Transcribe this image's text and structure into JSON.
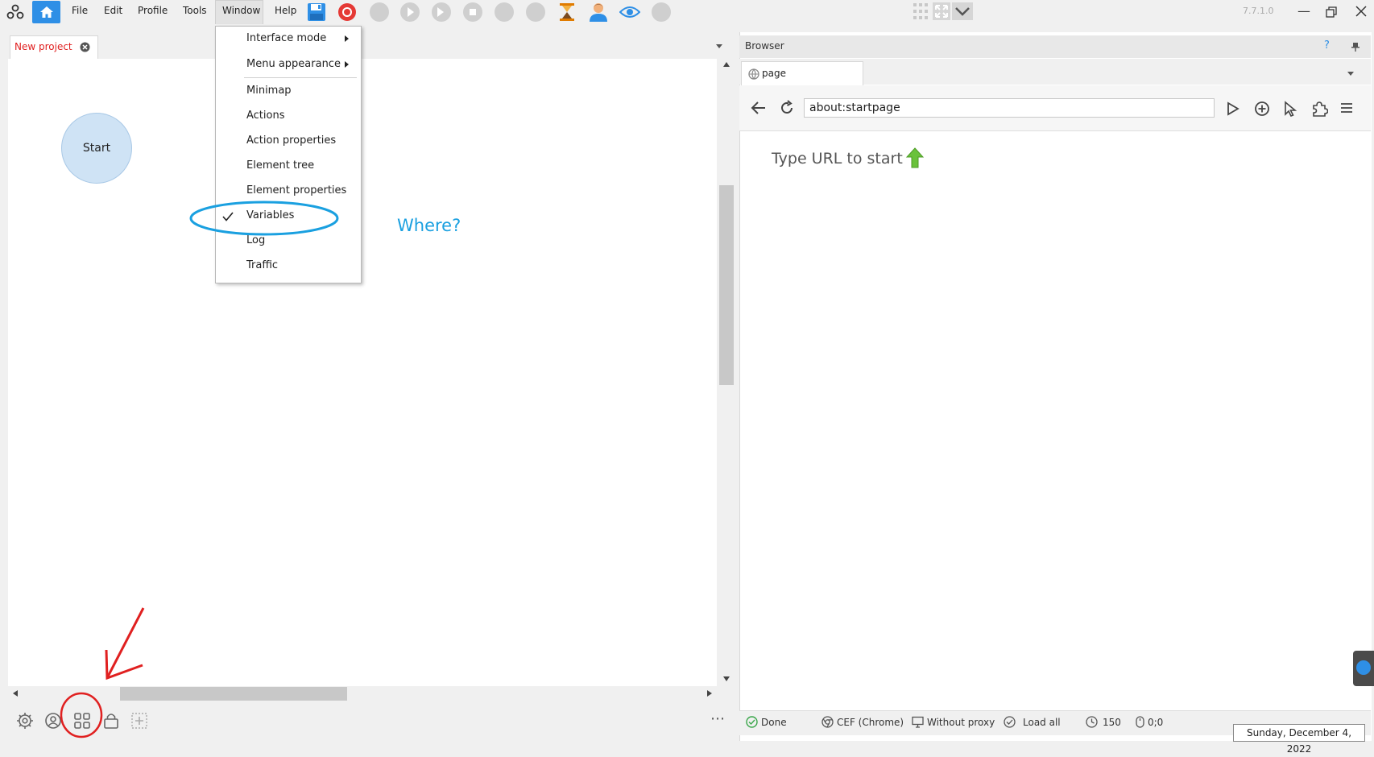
{
  "menu": {
    "file": "File",
    "edit": "Edit",
    "profile": "Profile",
    "tools": "Tools",
    "window": "Window",
    "help": "Help"
  },
  "version": "7.7.1.0",
  "project": {
    "tab_label": "New project",
    "start_node_label": "Start"
  },
  "window_menu": {
    "items": [
      {
        "label": "Interface mode",
        "submenu": true
      },
      {
        "label": "Menu appearance",
        "submenu": true
      },
      {
        "label": "Minimap"
      },
      {
        "label": "Actions"
      },
      {
        "label": "Action properties"
      },
      {
        "label": "Element tree"
      },
      {
        "label": "Element properties"
      },
      {
        "label": "Variables",
        "checked": true
      },
      {
        "label": "Log"
      },
      {
        "label": "Traffic"
      }
    ]
  },
  "annotation": {
    "where_text": "Where?"
  },
  "browser": {
    "header_title": "Browser",
    "help_glyph": "?",
    "tab_label": "page",
    "url_value": "about:startpage",
    "start_hint": "Type URL to start"
  },
  "status": {
    "done": "Done",
    "engine": "CEF (Chrome)",
    "proxy": "Without proxy",
    "load": "Load all",
    "timer": "150",
    "coords": "0;0"
  },
  "tooltip": {
    "date": "Sunday, December 4, 2022"
  },
  "colors": {
    "accent_blue": "#2e8fe6",
    "annotation_blue": "#1aa0e0",
    "annotation_red": "#e02020",
    "tab_red": "#e02020",
    "start_node_fill": "#cfe3f5",
    "start_node_stroke": "#a8c8e6",
    "record_red": "#e53935"
  }
}
